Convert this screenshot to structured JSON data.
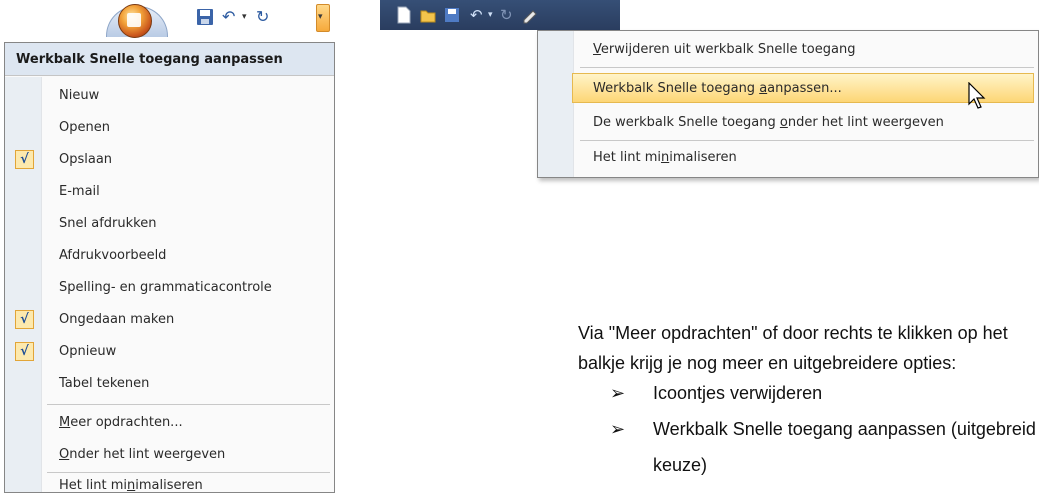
{
  "left_menu": {
    "title": "Werkbalk Snelle toegang aanpassen",
    "items": [
      {
        "label": "Nieuw",
        "checked": false
      },
      {
        "label": "Openen",
        "checked": false
      },
      {
        "label": "Opslaan",
        "checked": true
      },
      {
        "label": "E-mail",
        "checked": false
      },
      {
        "label": "Snel afdrukken",
        "checked": false
      },
      {
        "label": "Afdrukvoorbeeld",
        "checked": false
      },
      {
        "label": "Spelling- en grammaticacontrole",
        "checked": false
      },
      {
        "label": "Ongedaan maken",
        "checked": true
      },
      {
        "label": "Opnieuw",
        "checked": true
      },
      {
        "label": "Tabel tekenen",
        "checked": false
      }
    ],
    "more_a": "M",
    "more_b": "eer opdrachten...",
    "below_a": "O",
    "below_b": "nder het lint weergeven",
    "min_a": "Het lint mi",
    "min_b": "n",
    "min_c": "imaliseren"
  },
  "context_menu": {
    "item1_a": "V",
    "item1_b": "erwijderen uit werkbalk Snelle toegang",
    "item2_a": "Werkbalk Snelle toegang ",
    "item2_b": "a",
    "item2_c": "anpassen...",
    "item3_a": "De werkbalk Snelle toegang ",
    "item3_b": "o",
    "item3_c": "nder het lint weergeven",
    "item4_a": "Het lint mi",
    "item4_b": "n",
    "item4_c": "imaliseren"
  },
  "body_text": {
    "line1": "Via \"Meer opdrachten\" of door rechts te klikken op het",
    "line2": "balkje krijg je nog meer en uitgebreidere opties:",
    "bullet1": "Icoontjes verwijderen",
    "bullet2": "Werkbalk Snelle toegang aanpassen (uitgebreid",
    "bullet2_cont": "keuze)",
    "arrow": "➢"
  },
  "icons": {
    "checkmark": "√",
    "undo": "↶",
    "redo": "↻",
    "dropdown": "▾"
  },
  "colors": {
    "highlight_top": "#fff4c8",
    "highlight_bottom": "#fdd676",
    "title_bar": "#dde6f1",
    "toolbar_dark": "#2a3d5f"
  }
}
